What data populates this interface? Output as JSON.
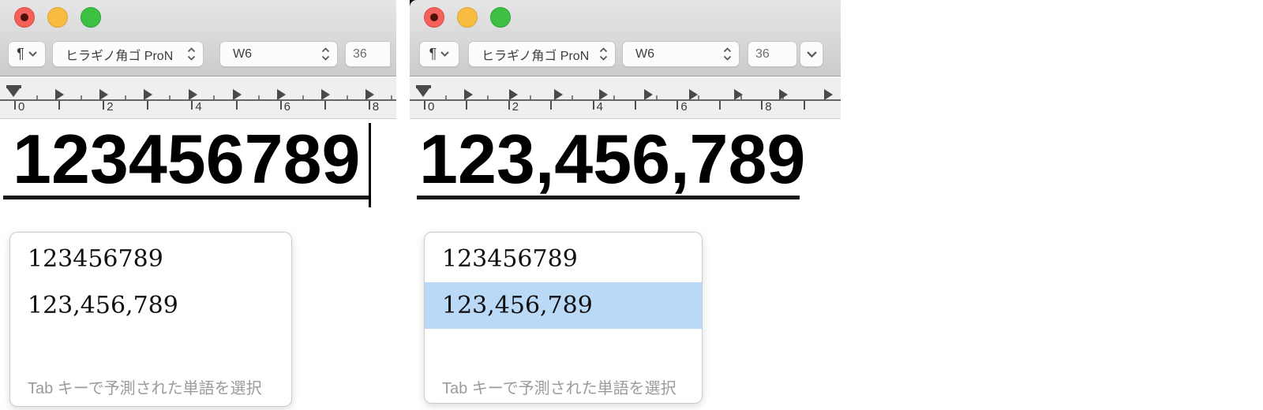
{
  "app": "TextEdit-style document windows with Japanese IME prediction popup",
  "colors": {
    "selection_highlight": "#b9d9f7",
    "traffic_red": "#f4605a",
    "traffic_yellow": "#f8bd40",
    "traffic_green": "#3ec043",
    "composition_underline": "#1a1a1a"
  },
  "windows": [
    {
      "side": "left",
      "window_controls": {
        "close": "close",
        "minimize": "minimize",
        "zoom": "zoom"
      },
      "toolbar": {
        "paragraph_label": "¶",
        "font_family_value": "ヒラギノ角ゴ ProN",
        "font_weight_value": "W6",
        "font_size_value": "36"
      },
      "ruler": {
        "unit_labels": [
          "0",
          "2",
          "4",
          "6",
          "8"
        ]
      },
      "document": {
        "composition_text": "123456789",
        "has_caret": true
      },
      "candidates": {
        "items": [
          "123456789",
          "123,456,789"
        ],
        "selected_index": -1,
        "hint": "Tab キーで予測された単語を選択"
      }
    },
    {
      "side": "right",
      "window_controls": {
        "close": "close",
        "minimize": "minimize",
        "zoom": "zoom"
      },
      "toolbar": {
        "paragraph_label": "¶",
        "font_family_value": "ヒラギノ角ゴ ProN",
        "font_weight_value": "W6",
        "font_size_value": "36"
      },
      "ruler": {
        "unit_labels": [
          "0",
          "2",
          "4",
          "6",
          "8"
        ]
      },
      "document": {
        "composition_text": "123,456,789",
        "has_caret": false
      },
      "candidates": {
        "items": [
          "123456789",
          "123,456,789"
        ],
        "selected_index": 1,
        "hint": "Tab キーで予測された単語を選択"
      }
    }
  ]
}
